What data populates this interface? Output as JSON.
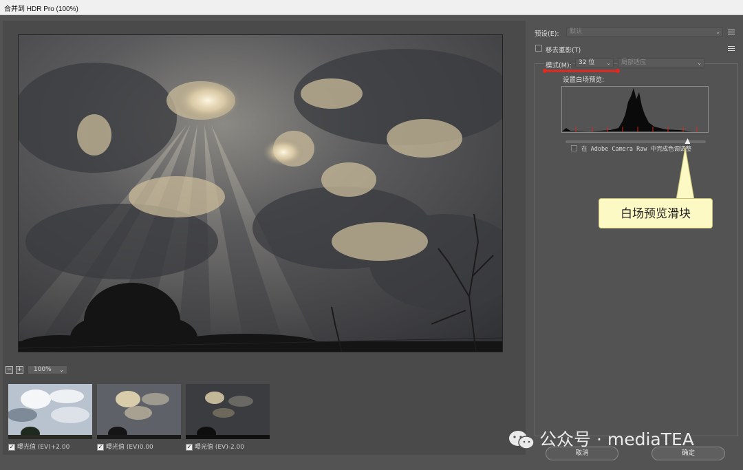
{
  "window": {
    "title": "合并到 HDR Pro (100%)"
  },
  "preset": {
    "label": "预设(E):",
    "value": "默认"
  },
  "ghost": {
    "label": "移去重影(T)",
    "checked": false
  },
  "mode": {
    "label": "模式(M):",
    "bit_value": "32 位",
    "method_value": "局部适应"
  },
  "white_point": {
    "label": "设置白场预览:",
    "slider_level": 0.87
  },
  "acr": {
    "label": "在 Adobe Camera Raw 中完成色调调整",
    "checked": false
  },
  "annotation": {
    "callout_text": "白场预览滑块",
    "underline_color": "#e8281c"
  },
  "zoom": {
    "minus": "−",
    "plus": "+",
    "value": "100%"
  },
  "thumbnails": [
    {
      "caption": "曝光值 (EV)+2.00",
      "checked": true
    },
    {
      "caption": "曝光值 (EV)0.00",
      "checked": true
    },
    {
      "caption": "曝光值 (EV)-2.00",
      "checked": true
    }
  ],
  "buttons": {
    "cancel": "取消",
    "ok": "确定"
  },
  "watermark": {
    "text": "公众号 · mediaTEA"
  },
  "icons": {
    "checkmark": "✓",
    "chevron": "⌄"
  },
  "colors": {
    "panel_bg": "#535353",
    "callout_bg": "#fdf9c4",
    "highlight_red": "#e8281c"
  }
}
